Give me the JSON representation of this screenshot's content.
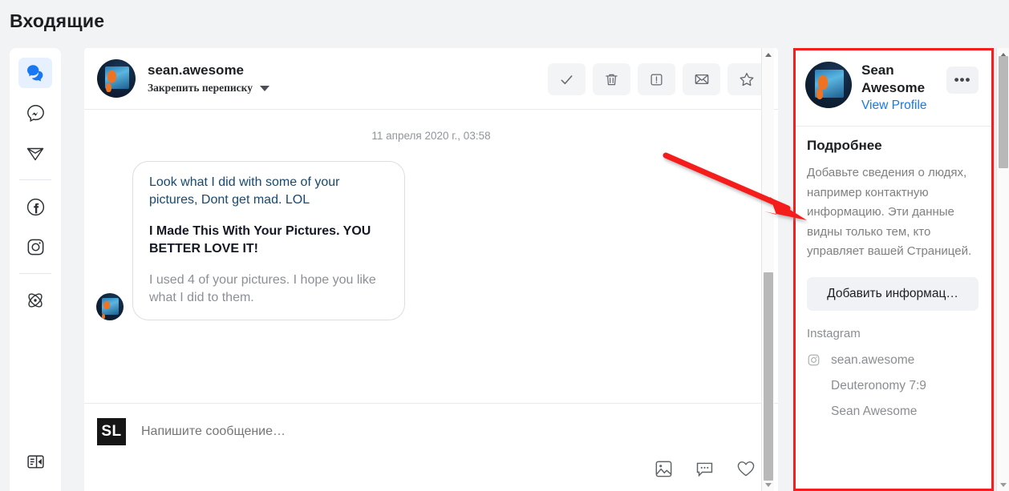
{
  "page": {
    "title": "Входящие",
    "accent_blue": "#1877f2",
    "annotation_red": "#f51d1d",
    "background": "#f2f3f5"
  },
  "sidebar": {
    "items": [
      {
        "name": "chats",
        "icon": "chat-bubbles-icon",
        "active": true
      },
      {
        "name": "messenger",
        "icon": "messenger-icon",
        "active": false
      },
      {
        "name": "send",
        "icon": "paper-plane-icon",
        "active": false
      },
      {
        "name": "facebook",
        "icon": "facebook-icon",
        "active": false
      },
      {
        "name": "instagram",
        "icon": "instagram-icon",
        "active": false
      },
      {
        "name": "automation",
        "icon": "atom-icon",
        "active": false
      }
    ],
    "bottom_item": {
      "name": "toggle-panel",
      "icon": "panel-toggle-icon"
    }
  },
  "conversation": {
    "header": {
      "name": "sean.awesome",
      "pin_label": "Закрепить переписку",
      "avatar_alt": "sean-awesome-avatar",
      "actions": [
        {
          "name": "mark-done-button",
          "icon": "check-icon"
        },
        {
          "name": "delete-button",
          "icon": "trash-icon"
        },
        {
          "name": "mark-spam-button",
          "icon": "exclamation-box-icon"
        },
        {
          "name": "mark-unread-button",
          "icon": "envelope-icon"
        },
        {
          "name": "favorite-button",
          "icon": "star-icon"
        }
      ]
    },
    "thread": {
      "date_divider": "11 апреля 2020 г., 03:58",
      "messages": [
        {
          "sender": "sean.awesome",
          "lines": [
            "Look what I did with some of your pictures, Dont get mad. LOL",
            "I Made This With Your Pictures. YOU BETTER LOVE IT!",
            "I used 4 of your pictures. I hope you like what I did to them."
          ]
        }
      ]
    },
    "composer": {
      "avatar_initials": "SL",
      "placeholder": "Напишите сообщение…",
      "value": "",
      "icons": [
        {
          "name": "attach-image-button",
          "icon": "image-icon"
        },
        {
          "name": "saved-replies-button",
          "icon": "chat-dots-icon"
        },
        {
          "name": "like-button",
          "icon": "heart-icon"
        }
      ]
    },
    "scrollbar": {
      "name": "conversation-scrollbar"
    }
  },
  "details": {
    "profile": {
      "name": "Sean Awesome",
      "view_profile_label": "View Profile",
      "menu_label": "•••"
    },
    "section_title": "Подробнее",
    "description": "Добавьте сведения о людях, например контактную информацию. Эти данные видны только тем, кто управляет вашей Страницей.",
    "add_info_button": "Добавить информац…",
    "instagram_section_label": "Instagram",
    "instagram_items": [
      {
        "label": "sean.awesome",
        "icon": "instagram-icon",
        "indent": false
      },
      {
        "label": "Deuteronomy 7:9",
        "icon": "",
        "indent": true
      },
      {
        "label": "Sean Awesome",
        "icon": "",
        "indent": true
      }
    ],
    "scrollbar": {
      "name": "details-scrollbar"
    }
  }
}
